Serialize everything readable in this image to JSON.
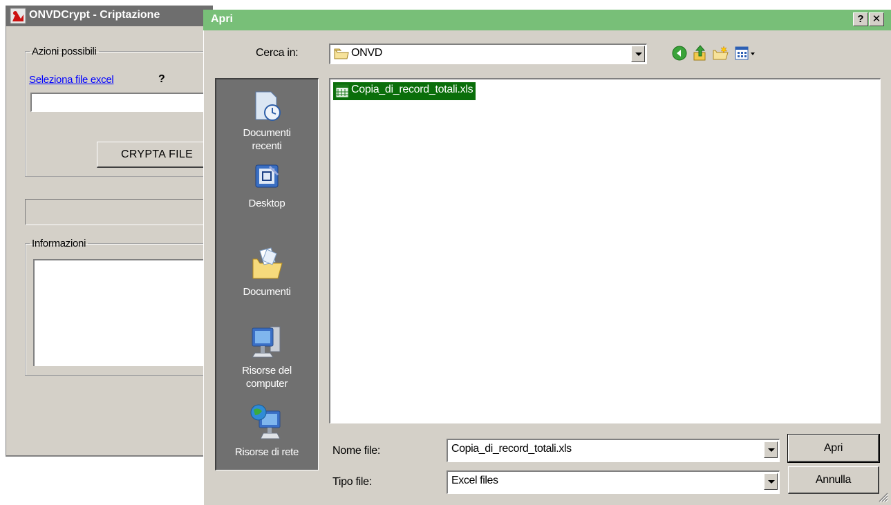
{
  "background_app": {
    "title": "ONVDCrypt - Criptazione",
    "group_actions_label": "Azioni possibili",
    "select_link": "Seleziona file excel",
    "help_mark": "?",
    "crypta_button": "CRYPTA FILE",
    "group_info_label": "Informazioni"
  },
  "dialog": {
    "title": "Apri",
    "help_button": "?",
    "close_button": "✕",
    "look_in_label": "Cerca in:",
    "look_in_value": "ONVD",
    "toolbar_icons": [
      "back-icon",
      "up-folder-icon",
      "new-folder-icon",
      "view-menu-icon"
    ],
    "places": [
      {
        "id": "recent",
        "label": "Documenti\nrecenti",
        "icon": "recent-documents-icon"
      },
      {
        "id": "desktop",
        "label": "Desktop",
        "icon": "desktop-icon"
      },
      {
        "id": "documents",
        "label": "Documenti",
        "icon": "my-documents-icon"
      },
      {
        "id": "computer",
        "label": "Risorse del\ncomputer",
        "icon": "my-computer-icon"
      },
      {
        "id": "network",
        "label": "Risorse di rete",
        "icon": "network-places-icon"
      }
    ],
    "files": [
      {
        "name": "Copia_di_record_totali.xls",
        "selected": true,
        "icon": "excel-file-icon"
      }
    ],
    "file_name_label": "Nome file:",
    "file_name_value": "Copia_di_record_totali.xls",
    "file_type_label": "Tipo file:",
    "file_type_value": "Excel files",
    "open_button": "Apri",
    "cancel_button": "Annulla"
  },
  "colors": {
    "window_face": "#d4d0c8",
    "dialog_titlebar": "#78bf78",
    "selection": "#0a6e0a",
    "places_bar": "#707070",
    "link": "#0000ff"
  }
}
